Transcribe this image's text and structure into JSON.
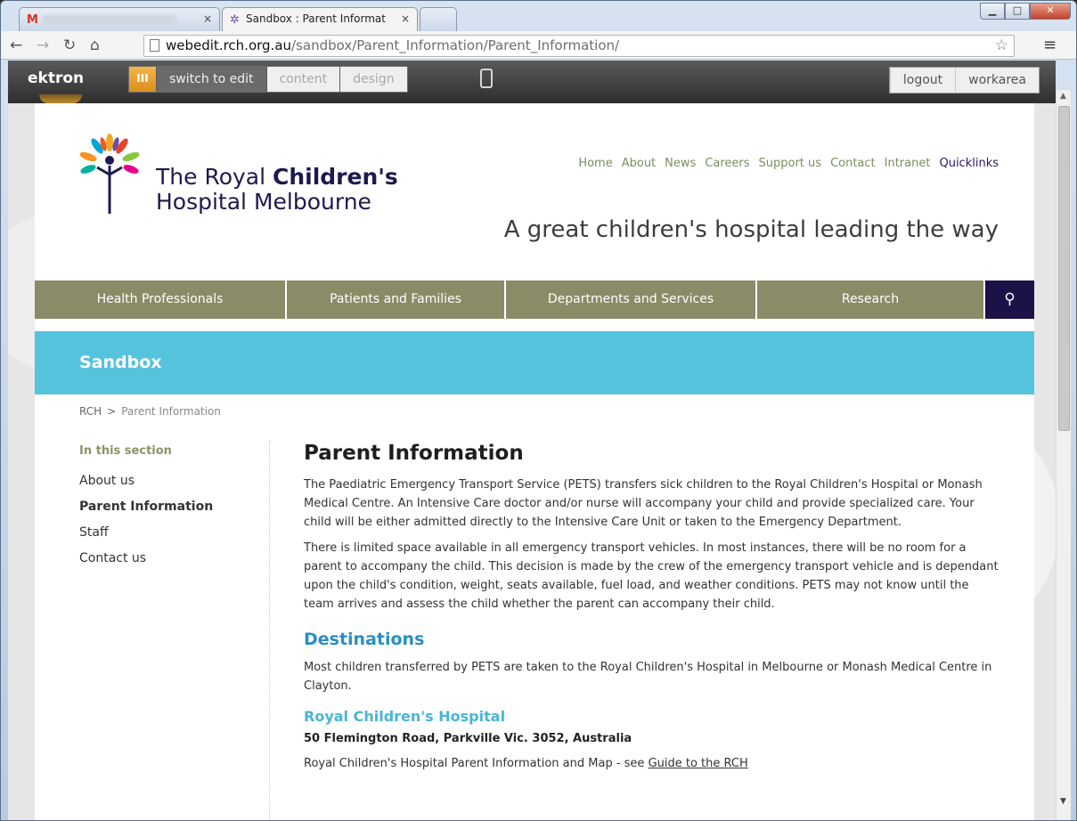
{
  "browser": {
    "tabs": [
      {
        "label": "",
        "close": "×"
      },
      {
        "label": "Sandbox : Parent Informat",
        "close": "×"
      }
    ],
    "url_host": "webedit.rch.org.au",
    "url_path": "/sandbox/Parent_Information/Parent_Information/"
  },
  "ektron": {
    "logo": "ektron",
    "orange": "III",
    "switch_to_edit": "switch to edit",
    "content": "content",
    "design": "design",
    "logout": "logout",
    "workarea": "workarea"
  },
  "site": {
    "logo_line1_a": "The Royal ",
    "logo_line1_b": "Children's",
    "logo_line2": "Hospital Melbourne",
    "tagline": "A great children's hospital leading the way",
    "topnav": [
      "Home",
      "About",
      "News",
      "Careers",
      "Support us",
      "Contact",
      "Intranet",
      "Quicklinks"
    ],
    "mainnav": [
      "Health Professionals",
      "Patients and Families",
      "Departments and Services",
      "Research"
    ],
    "banner_title": "Sandbox"
  },
  "breadcrumb": {
    "root": "RCH",
    "sep": ">",
    "current": "Parent Information"
  },
  "sidenav": {
    "heading": "In this section",
    "items": [
      "About us",
      "Parent Information",
      "Staff",
      "Contact us"
    ]
  },
  "content": {
    "title": "Parent Information",
    "p1": "The Paediatric Emergency Transport Service (PETS) transfers sick children to the Royal Children's Hospital or Monash Medical Centre. An Intensive Care doctor and/or nurse will accompany your child and provide specialized care. Your child will be either admitted directly to the Intensive Care Unit or taken to the Emergency Department.",
    "p2": "There is limited space available in all emergency transport vehicles.  In most instances, there will be no room for a parent to accompany the child.  This decision is made by the crew of the emergency transport vehicle and is dependant upon the child's condition, weight, seats available, fuel load, and weather conditions.  PETS may not know until the team arrives and assess the child whether the parent can accompany their child.",
    "h2": "Destinations",
    "p3": "Most children transferred by PETS are taken to the Royal Children's Hospital in Melbourne or Monash Medical Centre in Clayton.",
    "h3": "Royal Children's Hospital",
    "address": "50 Flemington Road, Parkville Vic. 3052, Australia",
    "p4_prefix": "Royal Children's Hospital Parent Information and Map - see ",
    "p4_link": "Guide to the RCH"
  }
}
